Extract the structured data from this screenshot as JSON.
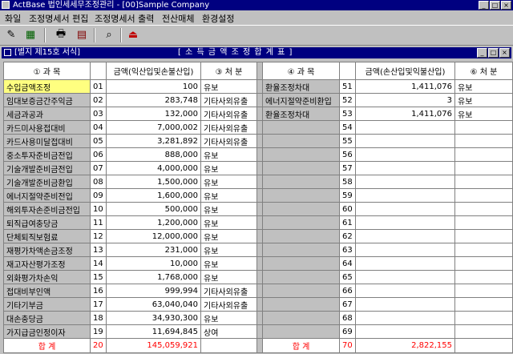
{
  "window": {
    "title": "ActBase 법인세세무조정관리 - [00]Sample Company"
  },
  "menu": [
    "화일",
    "조정명세서 편집",
    "조정명세서 출력",
    "전산매체",
    "환경설정"
  ],
  "child": {
    "form_label": "[별지 제15호 서식]",
    "title": "[ 소 득 금 액 조 정 합 계 표 ]"
  },
  "headers": {
    "left_item": "① 과 목",
    "left_amount": "금액(익산입및손불산입)",
    "left_type": "③ 처 분",
    "right_item": "④ 과 목",
    "right_amount": "금액(손산입및익불산입)",
    "right_type": "⑥ 처 분"
  },
  "left_rows": [
    {
      "item": "수입금액조정",
      "code": "01",
      "amount": "100",
      "type": "유보"
    },
    {
      "item": "임대보증금간주익금",
      "code": "02",
      "amount": "283,748",
      "type": "기타사외유출"
    },
    {
      "item": "세금과공과",
      "code": "03",
      "amount": "132,000",
      "type": "기타사외유출"
    },
    {
      "item": "카드미사용접대비",
      "code": "04",
      "amount": "7,000,002",
      "type": "기타사외유출"
    },
    {
      "item": "카드사용미달접대비",
      "code": "05",
      "amount": "3,281,892",
      "type": "기타사외유출"
    },
    {
      "item": "중소투자준비금전입",
      "code": "06",
      "amount": "888,000",
      "type": "유보"
    },
    {
      "item": "기술개발준비금전입",
      "code": "07",
      "amount": "4,000,000",
      "type": "유보"
    },
    {
      "item": "기술개발준비금환입",
      "code": "08",
      "amount": "1,500,000",
      "type": "유보"
    },
    {
      "item": "에너지절약준비전입",
      "code": "09",
      "amount": "1,600,000",
      "type": "유보"
    },
    {
      "item": "해외투자손준비금전입",
      "code": "10",
      "amount": "500,000",
      "type": "유보"
    },
    {
      "item": "퇴직급여충당금",
      "code": "11",
      "amount": "1,200,000",
      "type": "유보"
    },
    {
      "item": "단체퇴직보험료",
      "code": "12",
      "amount": "12,000,000",
      "type": "유보"
    },
    {
      "item": "재평가차액손금조정",
      "code": "13",
      "amount": "231,000",
      "type": "유보"
    },
    {
      "item": "재고자산평가조정",
      "code": "14",
      "amount": "10,000",
      "type": "유보"
    },
    {
      "item": "외화평가차손익",
      "code": "15",
      "amount": "1,768,000",
      "type": "유보"
    },
    {
      "item": "접대비부인액",
      "code": "16",
      "amount": "999,994",
      "type": "기타사외유출"
    },
    {
      "item": "기타기부금",
      "code": "17",
      "amount": "63,040,040",
      "type": "기타사외유출"
    },
    {
      "item": "대손충당금",
      "code": "18",
      "amount": "34,930,300",
      "type": "유보"
    },
    {
      "item": "가지급금인정이자",
      "code": "19",
      "amount": "11,694,845",
      "type": "상여"
    }
  ],
  "right_rows": [
    {
      "item": "환율조정차대",
      "code": "51",
      "amount": "1,411,076",
      "type": "유보"
    },
    {
      "item": "에너지절약준비환입",
      "code": "52",
      "amount": "3",
      "type": "유보"
    },
    {
      "item": "환율조정차대",
      "code": "53",
      "amount": "1,411,076",
      "type": "유보"
    },
    {
      "item": "",
      "code": "54",
      "amount": "",
      "type": ""
    },
    {
      "item": "",
      "code": "55",
      "amount": "",
      "type": ""
    },
    {
      "item": "",
      "code": "56",
      "amount": "",
      "type": ""
    },
    {
      "item": "",
      "code": "57",
      "amount": "",
      "type": ""
    },
    {
      "item": "",
      "code": "58",
      "amount": "",
      "type": ""
    },
    {
      "item": "",
      "code": "59",
      "amount": "",
      "type": ""
    },
    {
      "item": "",
      "code": "60",
      "amount": "",
      "type": ""
    },
    {
      "item": "",
      "code": "61",
      "amount": "",
      "type": ""
    },
    {
      "item": "",
      "code": "62",
      "amount": "",
      "type": ""
    },
    {
      "item": "",
      "code": "63",
      "amount": "",
      "type": ""
    },
    {
      "item": "",
      "code": "64",
      "amount": "",
      "type": ""
    },
    {
      "item": "",
      "code": "65",
      "amount": "",
      "type": ""
    },
    {
      "item": "",
      "code": "66",
      "amount": "",
      "type": ""
    },
    {
      "item": "",
      "code": "67",
      "amount": "",
      "type": ""
    },
    {
      "item": "",
      "code": "68",
      "amount": "",
      "type": ""
    },
    {
      "item": "",
      "code": "69",
      "amount": "",
      "type": ""
    }
  ],
  "totals": {
    "left_label": "합 계",
    "left_code": "20",
    "left_amount": "145,059,921",
    "right_label": "합 계",
    "right_code": "70",
    "right_amount": "2,822,155"
  }
}
